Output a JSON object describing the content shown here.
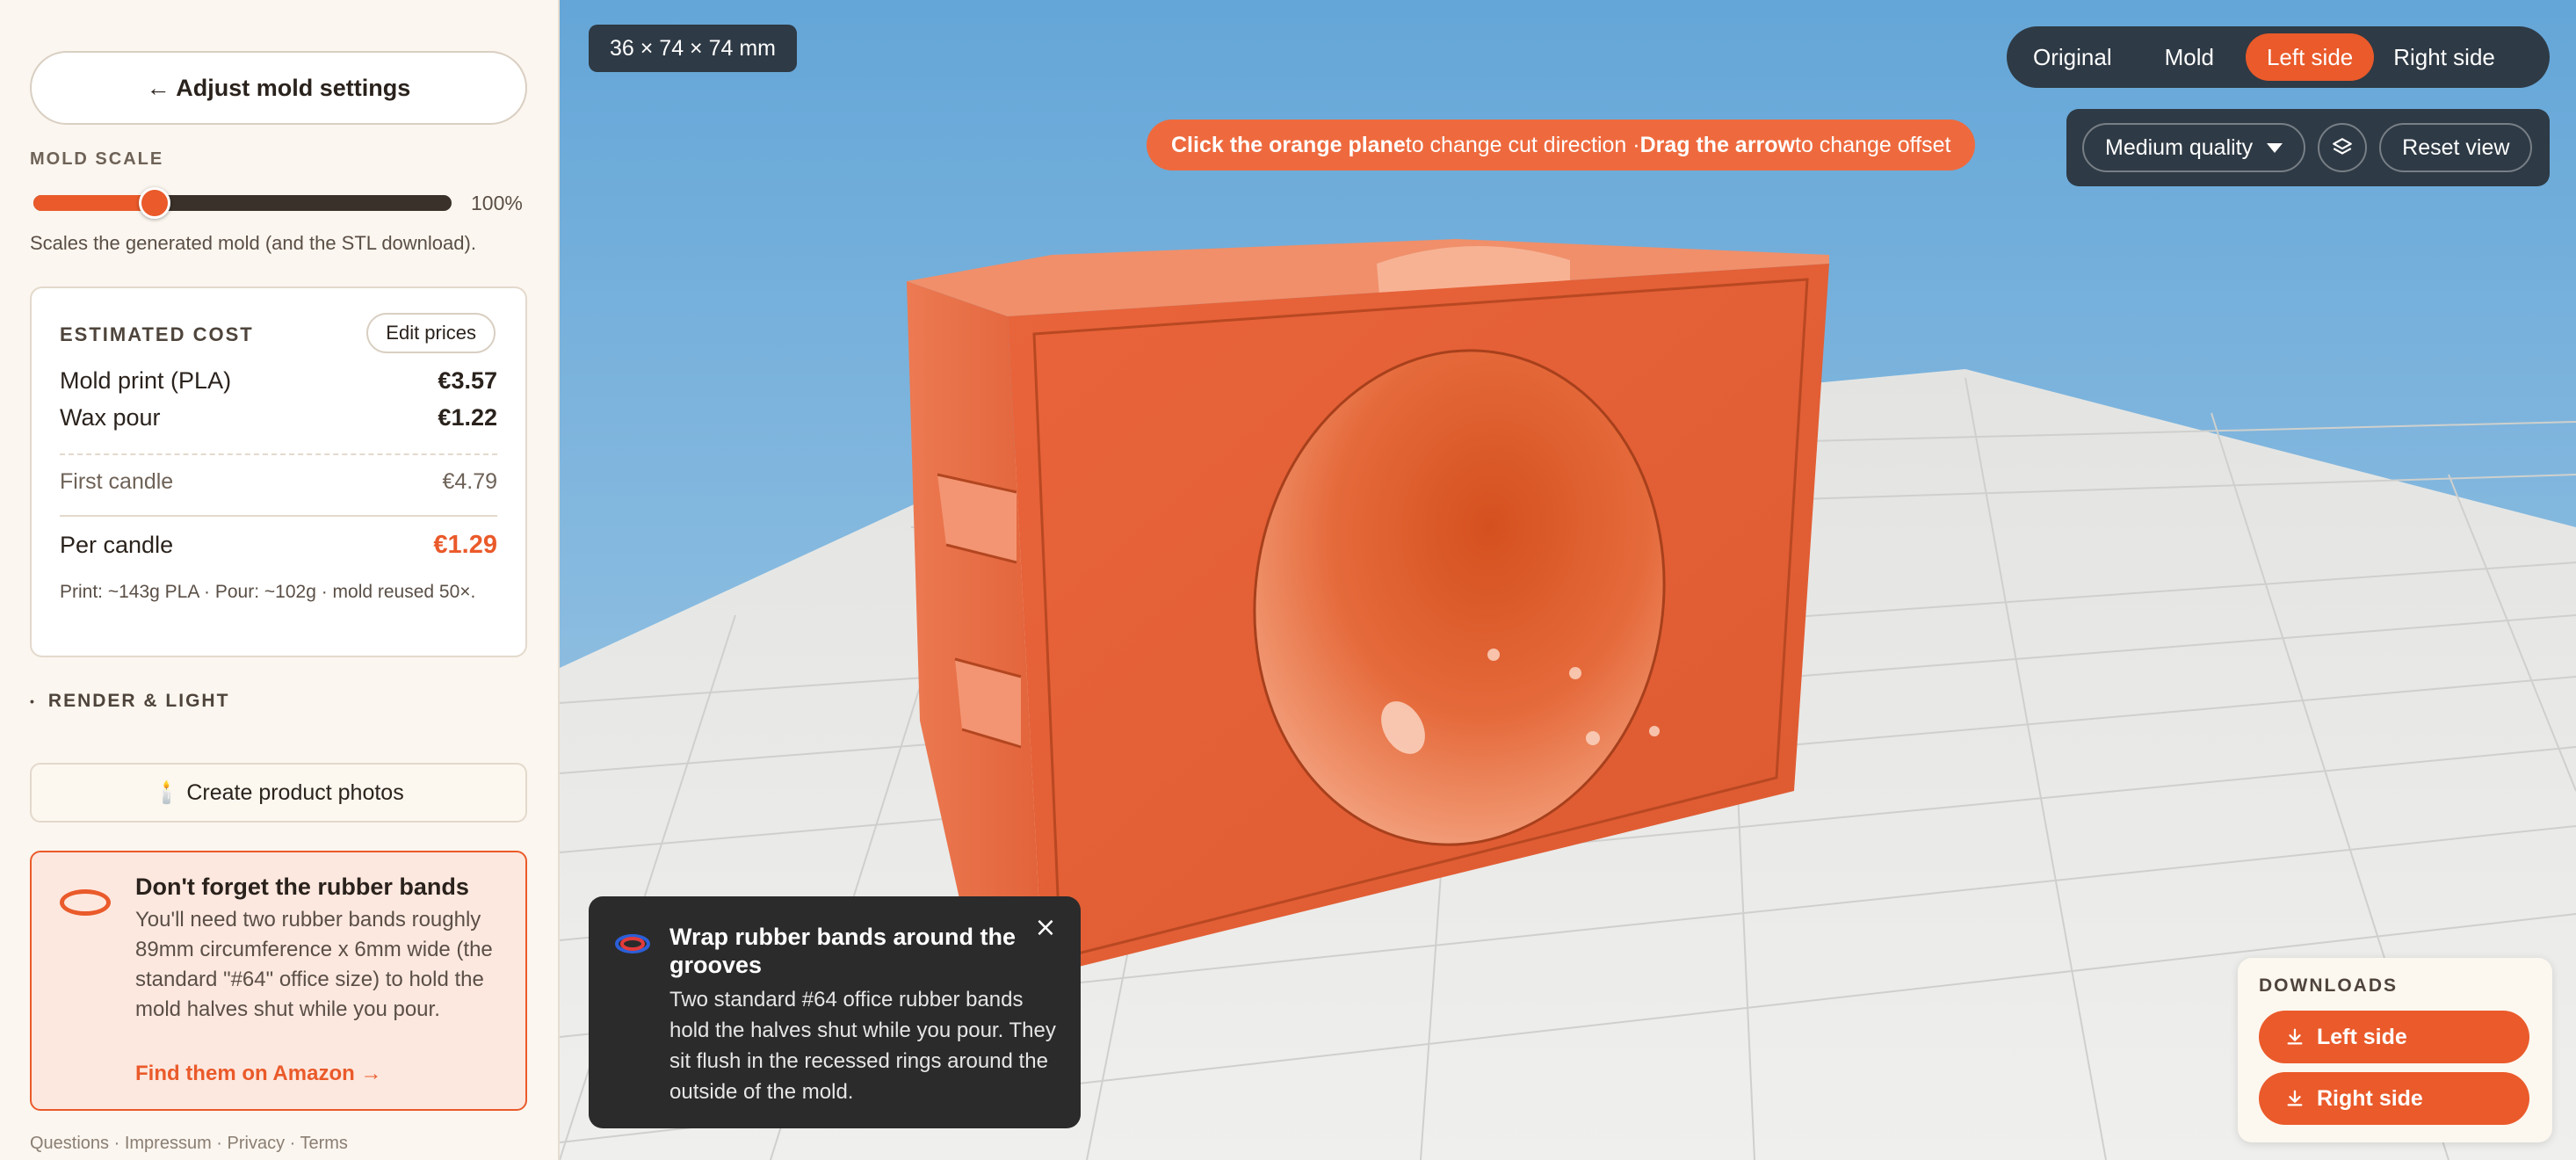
{
  "sidebar": {
    "back_button": "← Adjust mold settings",
    "mold_scale": {
      "label": "MOLD SCALE",
      "value_text": "100%",
      "fraction": 0.29,
      "help": "Scales the generated mold (and the STL download)."
    },
    "cost": {
      "title": "ESTIMATED COST",
      "edit_label": "Edit prices",
      "rows": {
        "mold_print": {
          "label": "Mold print (PLA)",
          "value": "€3.57"
        },
        "wax_pour": {
          "label": "Wax pour",
          "value": "€1.22"
        },
        "first_candle": {
          "label": "First candle",
          "value": "€4.79"
        },
        "per_candle": {
          "label": "Per candle",
          "value": "€1.29"
        }
      },
      "note": "Print: ~143g PLA · Pour: ~102g · mold reused 50×."
    },
    "render_section": "RENDER & LIGHT",
    "photos_button": "🕯️ Create product photos",
    "bands": {
      "title": "Don't forget the rubber bands",
      "text": "You'll need two rubber bands roughly 89mm circumference x 6mm wide (the standard \"#64\" office size) to hold the mold halves shut while you pour.",
      "link": "Find them on Amazon →"
    },
    "footer": "Questions · Impressum · Privacy · Terms"
  },
  "viewport": {
    "dimensions": "36 × 74 × 74 mm",
    "hint": {
      "part1": "Click the orange plane",
      "part2": " to change cut direction · ",
      "part3": "Drag the arrow",
      "part4": " to change offset"
    },
    "view_tabs": [
      "Original",
      "Mold",
      "Left side",
      "Right side"
    ],
    "active_tab": "Left side",
    "quality": "Medium quality",
    "reset_label": "Reset view",
    "tip": {
      "title": "Wrap rubber bands around the grooves",
      "text": "Two standard #64 office rubber bands hold the halves shut while you pour. They sit flush in the recessed rings around the outside of the mold.",
      "close": "×"
    },
    "downloads": {
      "label": "DOWNLOADS",
      "left": "Left side",
      "right": "Right side"
    }
  },
  "colors": {
    "accent": "#ea5a2a",
    "panel_dark": "#2e3a45",
    "mold": "#e8623a"
  }
}
